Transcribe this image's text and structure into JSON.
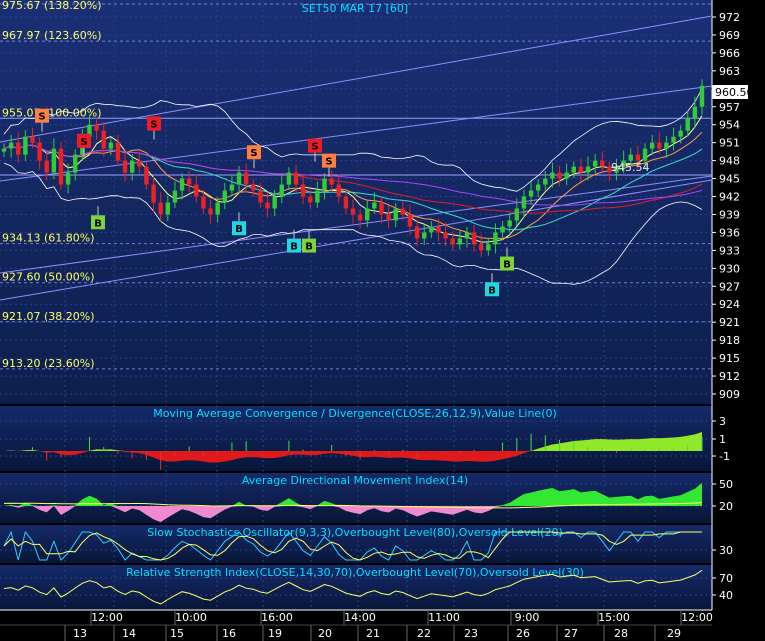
{
  "chart_data": {
    "type": "candlestick",
    "title": "SET50 MAR 17",
    "interval": "[60]",
    "last_price": "960.50",
    "annotation_price": "945.54",
    "y_axis_ticks": [
      972,
      969,
      966,
      963,
      960,
      957,
      954,
      951,
      948,
      945,
      942,
      939,
      936,
      933,
      930,
      927,
      924,
      921,
      918,
      915,
      912,
      909
    ],
    "ylim": [
      906,
      975
    ],
    "fib_levels": [
      {
        "label": "975.67 (138.20%)",
        "value": 975.67
      },
      {
        "label": "967.97 (123.60%)",
        "value": 967.97
      },
      {
        "label": "955.07 (100.00%)",
        "value": 955.07
      },
      {
        "label": "934.13 (61.80%)",
        "value": 934.13
      },
      {
        "label": "927.60 (50.00%)",
        "value": 927.6
      },
      {
        "label": "921.07 (38.20%)",
        "value": 921.07
      },
      {
        "label": "913.20 (23.60%)",
        "value": 913.2
      }
    ],
    "close_series": [
      950,
      951,
      949,
      952,
      951,
      948,
      946,
      950,
      944,
      946,
      949,
      952,
      954,
      953,
      950,
      951,
      948,
      946,
      948,
      947,
      944,
      941,
      939,
      941,
      943,
      945,
      944,
      942,
      940,
      939,
      941,
      943,
      944,
      946,
      944,
      943,
      941,
      940,
      942,
      944,
      946,
      944,
      942,
      941,
      943,
      945,
      944,
      942,
      940,
      939,
      938,
      940,
      941,
      939,
      938,
      940,
      939,
      937,
      935,
      936,
      937,
      936,
      935,
      934,
      935,
      936,
      934,
      933,
      934,
      936,
      937,
      938,
      940,
      942,
      943,
      944,
      945,
      946,
      945,
      946,
      947,
      946,
      947,
      948,
      947,
      946,
      947,
      948,
      949,
      948,
      950,
      951,
      950,
      951,
      952,
      953,
      955,
      957,
      960.5
    ],
    "signals": [
      {
        "label": "S",
        "color": "#ff7f3f",
        "x": 42,
        "value": 955.5
      },
      {
        "label": "S",
        "color": "#ee1c24",
        "x": 84,
        "value": 951.3
      },
      {
        "label": "S",
        "color": "#ee1c24",
        "x": 154,
        "value": 954.2
      },
      {
        "label": "S",
        "color": "#ff7f3f",
        "x": 254,
        "value": 949.4
      },
      {
        "label": "S",
        "color": "#ee1c24",
        "x": 315,
        "value": 950.5
      },
      {
        "label": "S",
        "color": "#ff7f3f",
        "x": 329,
        "value": 948.0
      },
      {
        "label": "B",
        "color": "#7fd33a",
        "x": 98,
        "value": 937.7
      },
      {
        "label": "B",
        "color": "#7fd33a",
        "x": 309,
        "value": 933.8
      },
      {
        "label": "B",
        "color": "#7fd33a",
        "x": 507,
        "value": 930.8
      },
      {
        "label": "B",
        "color": "#1ed6e6",
        "x": 239,
        "value": 936.7
      },
      {
        "label": "B",
        "color": "#1ed6e6",
        "x": 294,
        "value": 933.8
      },
      {
        "label": "B",
        "color": "#1ed6e6",
        "x": 492,
        "value": 926.5
      }
    ],
    "indicators": [
      {
        "title": "Moving Average Convergence / Divergence(CLOSE,26,12,9),Value Line(0)",
        "ticks": [
          "3",
          "1",
          "-1"
        ]
      },
      {
        "title": "Average Directional Movement Index(14)",
        "ticks": [
          "50",
          "20"
        ]
      },
      {
        "title": "Slow Stochastics Oscillator(9,3,3),Overbought Level(80),Oversold Level(20)",
        "ticks": [
          "30"
        ]
      },
      {
        "title": "Relative Strength Index(CLOSE,14,30,70),Overbought Level(70),Oversold Level(30)",
        "ticks": [
          "70",
          "40"
        ]
      }
    ],
    "time_labels": [
      "12:00",
      "10:00",
      "16:00",
      "14:00",
      "11:00",
      "9:00",
      "15:00",
      "12:00"
    ],
    "date_labels": [
      "13",
      "14",
      "15",
      "16",
      "19",
      "20",
      "21",
      "22",
      "23",
      "26",
      "27",
      "28",
      "29"
    ]
  }
}
